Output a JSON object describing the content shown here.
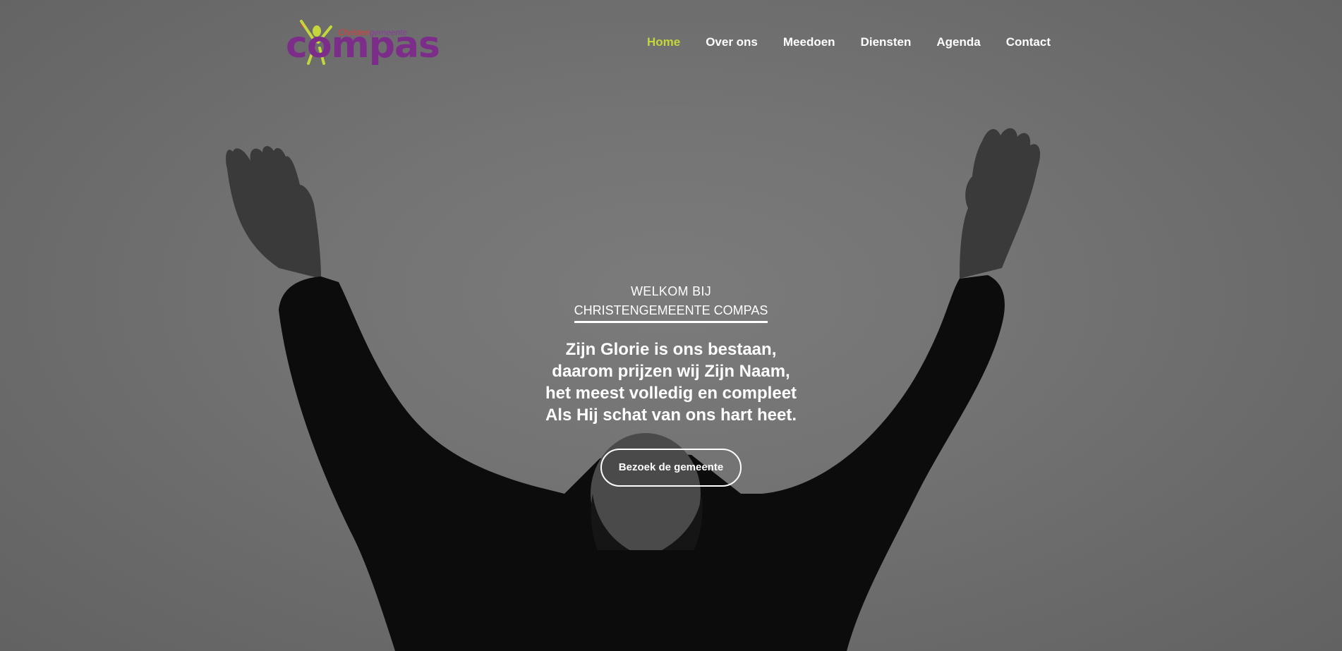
{
  "header": {
    "logo": {
      "title": "compas",
      "subtitle_part1": "Christen",
      "subtitle_part2": "gemeente",
      "colors": {
        "title": "#7c2d8a",
        "figure": "#c5d63c",
        "accent": "#e03a3a"
      }
    },
    "nav": [
      {
        "label": "Home",
        "active": true
      },
      {
        "label": "Over ons",
        "active": false
      },
      {
        "label": "Meedoen",
        "active": false
      },
      {
        "label": "Diensten",
        "active": false
      },
      {
        "label": "Agenda",
        "active": false
      },
      {
        "label": "Contact",
        "active": false
      }
    ],
    "active_color": "#c5d63c"
  },
  "hero": {
    "welcome": "WELKOM BIJ",
    "church_name": "CHRISTENGEMEENTE COMPAS",
    "quote_lines": [
      "Zijn Glorie is ons bestaan,",
      "daarom prijzen wij Zijn Naam,",
      "het meest volledig en compleet",
      "Als Hij schat van ons hart heet."
    ],
    "cta_label": "Bezoek de gemeente"
  }
}
